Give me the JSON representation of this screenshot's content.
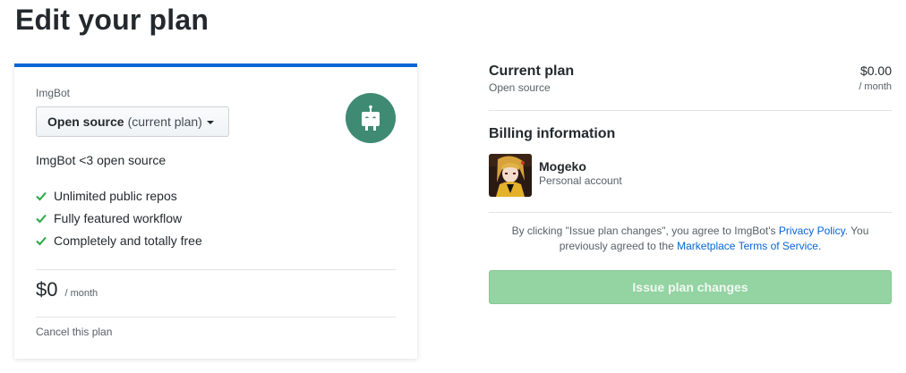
{
  "page": {
    "title": "Edit your plan"
  },
  "plan_card": {
    "app_name": "ImgBot",
    "select": {
      "plan_name": "Open source",
      "note": "(current plan)"
    },
    "description": "ImgBot <3 open source",
    "features": [
      "Unlimited public repos",
      "Fully featured workflow",
      "Completely and totally free"
    ],
    "price": {
      "amount": "$0",
      "period": "/ month"
    },
    "cancel_label": "Cancel this plan",
    "logo_color": "#3f8a73",
    "accent_color": "#0366d6"
  },
  "summary": {
    "current_plan": {
      "title": "Current plan",
      "plan_name": "Open source",
      "price": "$0.00",
      "period": "/ month"
    },
    "billing": {
      "title": "Billing information",
      "account_name": "Mogeko",
      "account_type": "Personal account"
    },
    "terms": {
      "prefix": "By clicking \"Issue plan changes\", you agree to ImgBot's ",
      "privacy_link": "Privacy Policy",
      "middle": ". You previously agreed to the ",
      "tos_link": "Marketplace Terms of Service",
      "suffix": "."
    },
    "issue_button_label": "Issue plan changes",
    "issue_button_color": "#94d3a2"
  },
  "icons": {
    "check": "check-icon",
    "logo": "robot-icon",
    "caret": "caret-down-icon"
  }
}
